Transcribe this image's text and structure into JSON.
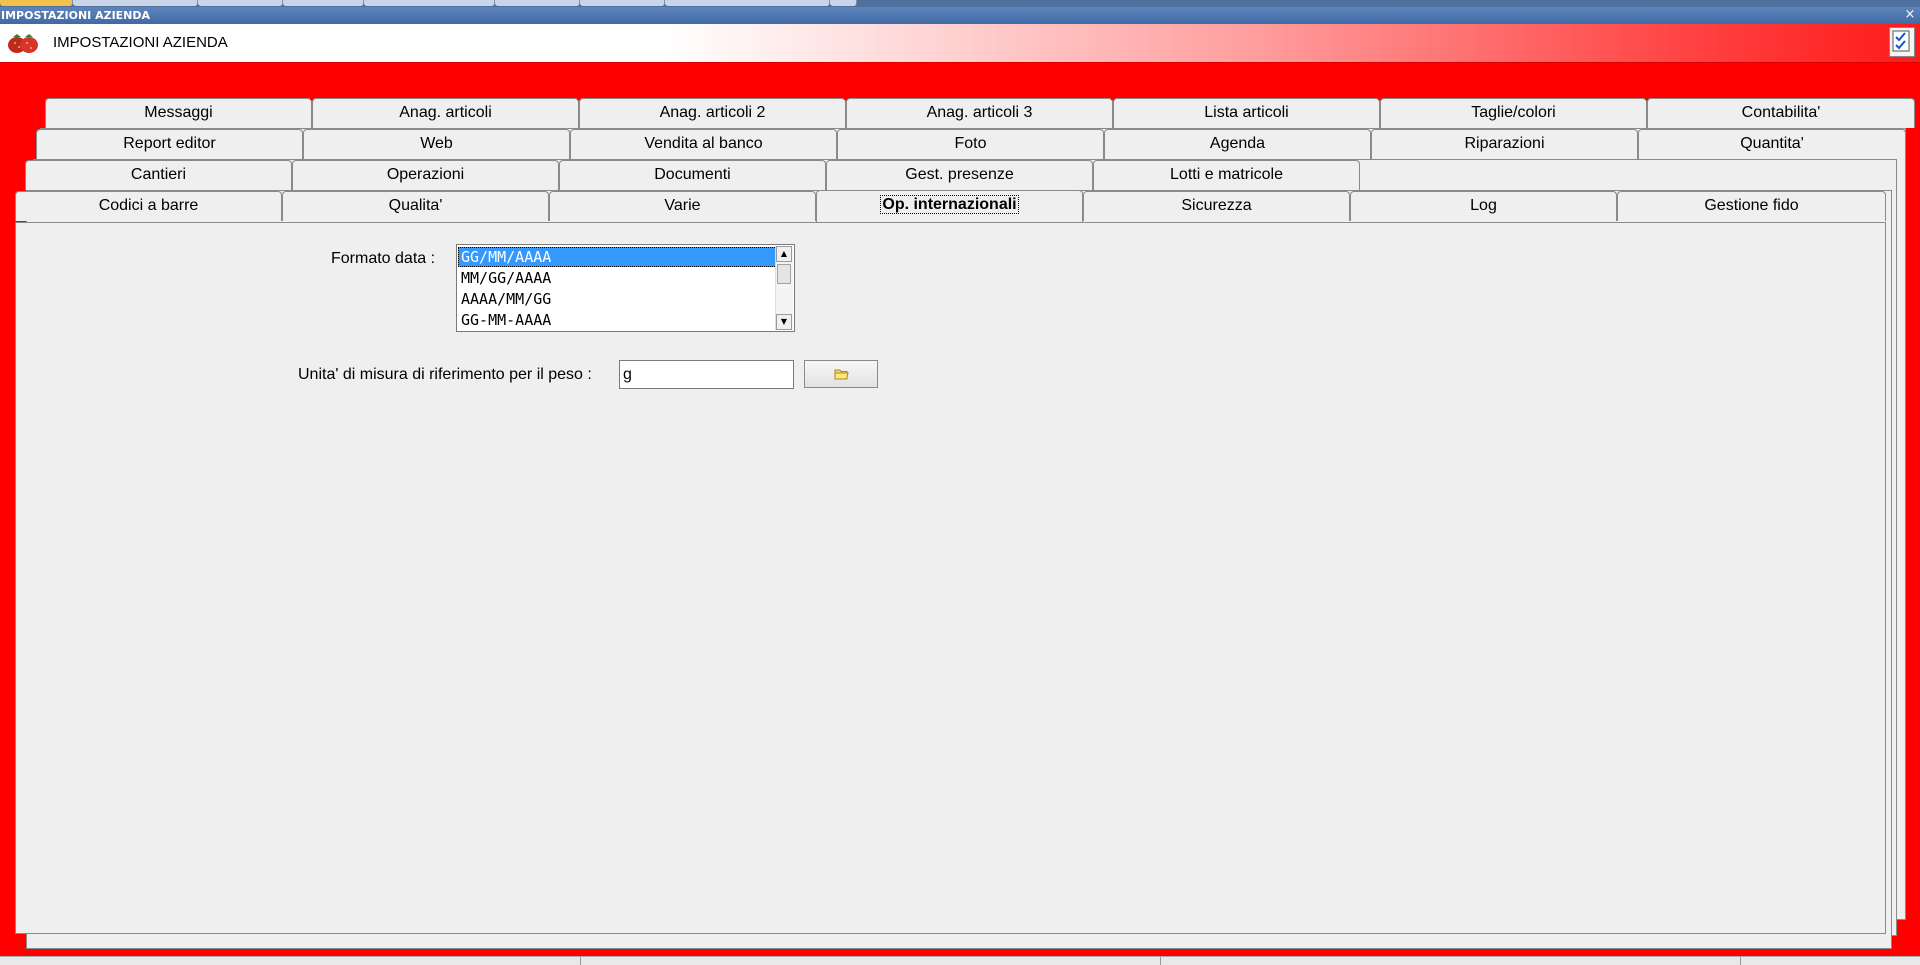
{
  "window": {
    "title": "IMPOSTAZIONI AZIENDA",
    "close_glyph": "×"
  },
  "header": {
    "title": "IMPOSTAZIONI AZIENDA",
    "logo_icon": "strawberry-icon",
    "tool_icon": "checklist-icon"
  },
  "tabs": {
    "row1": [
      "Messaggi",
      "Anag. articoli",
      "Anag. articoli 2",
      "Anag. articoli 3",
      "Lista articoli",
      "Taglie/colori",
      "Contabilita'"
    ],
    "row2": [
      "Report editor",
      "Web",
      "Vendita al banco",
      "Foto",
      "Agenda",
      "Riparazioni",
      "Quantita'"
    ],
    "row3": [
      "Cantieri",
      "Operazioni",
      "Documenti",
      "Gest. presenze",
      "Lotti e matricole"
    ],
    "row4": [
      "Codici a barre",
      "Qualita'",
      "Varie",
      "Op. internazionali",
      "Sicurezza",
      "Log",
      "Gestione fido"
    ],
    "active": "Op. internazionali"
  },
  "form": {
    "date_format": {
      "label": "Formato data :",
      "options": [
        "GG/MM/AAAA",
        "MM/GG/AAAA",
        "AAAA/MM/GG",
        "GG-MM-AAAA"
      ],
      "selected": "GG/MM/AAAA"
    },
    "weight_unit": {
      "label": "Unita' di misura di riferimento per il peso :",
      "value": "g",
      "browse_icon": "folder-icon"
    }
  },
  "colors": {
    "background": "#ff0000",
    "selection": "#3399ff",
    "panel": "#efefef"
  }
}
